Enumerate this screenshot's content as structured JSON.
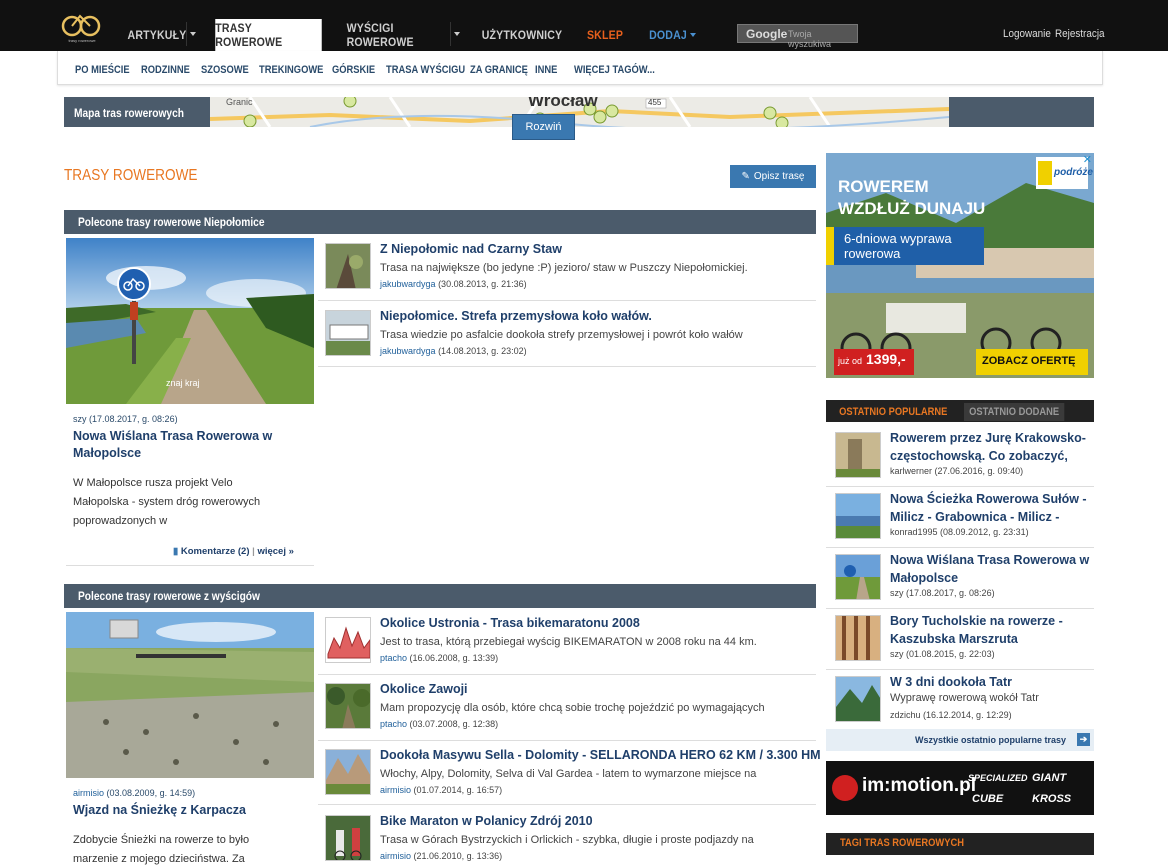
{
  "nav": {
    "items": [
      "Artykuły",
      "Trasy rowerowe",
      "Wyścigi rowerowe",
      "Użytkownicy",
      "Sklep",
      "Dodaj"
    ],
    "search_placeholder": "Twoja wyszukiwa",
    "search_brand": "Google",
    "login": "Logowanie",
    "register": "Rejestracja"
  },
  "subnav": [
    "Po mieście",
    "Rodzinne",
    "Szosowe",
    "Trekingowe",
    "Górskie",
    "Trasa wyścigu",
    "Za granicę",
    "Inne",
    "Więcej tagów..."
  ],
  "map": {
    "label": "Mapa tras rowerowych",
    "expand": "Rozwiń",
    "place_label": "Wrocław",
    "road": "455",
    "place2": "Granic"
  },
  "page_title": "Trasy rowerowe",
  "add_route_button": "Opisz trasę",
  "section1": {
    "title": "Polecone trasy rowerowe Niepołomice",
    "feature": {
      "meta": "szy (17.08.2017, g. 08:26)",
      "title": "Nowa Wiślana Trasa Rowerowa w Małopolsce",
      "desc": "W Małopolsce rusza projekt Velo Małopolska - system dróg rowerowych poprowadzonych w",
      "comments": "Komentarze (2)",
      "more": "więcej »",
      "watermark": "znaj kraj"
    },
    "items": [
      {
        "title": "Z Niepołomic nad Czarny Staw",
        "desc": "Trasa na największe (bo jedyne :P) jezioro/ staw w Puszczy Niepołomickiej.",
        "author": "jakubwardyga",
        "date": "(30.08.2013, g. 21:36)"
      },
      {
        "title": "Niepołomice. Strefa przemysłowa koło wałów.",
        "desc": "Trasa wiedzie po asfalcie dookoła strefy przemysłowej i powrót koło wałów",
        "author": "jakubwardyga",
        "date": "(14.08.2013, g. 23:02)"
      }
    ]
  },
  "section2": {
    "title": "Polecone trasy rowerowe z wyścigów",
    "feature": {
      "meta_author": "airmisio",
      "meta_date": "(03.08.2009, g. 14:59)",
      "title": "Wjazd na Śnieżkę z Karpacza",
      "desc": "Zdobycie Śnieżki na rowerze to było marzenie z mojego dzieciństwa. Za"
    },
    "items": [
      {
        "title": "Okolice Ustronia - Trasa bikemaratonu 2008",
        "desc": "Jest to trasa, którą przebiegał wyścig BIKEMARATON w 2008 roku na 44 km.",
        "author": "ptacho",
        "date": "(16.06.2008, g. 13:39)"
      },
      {
        "title": "Okolice Zawoji",
        "desc": "Mam propozycję dla osób, które chcą sobie trochę pojeździć po wymagających",
        "author": "ptacho",
        "date": "(03.07.2008, g. 12:38)"
      },
      {
        "title": "Dookoła Masywu Sella - Dolomity - SELLARONDA HERO 62 KM / 3.300 HM",
        "desc": "Włochy, Alpy, Dolomity, Selva di Val Gardea - latem to wymarzone miejsce na",
        "author": "airmisio",
        "date": "(01.07.2014, g. 16:57)"
      },
      {
        "title": "Bike Maraton w Polanicy Zdrój 2010",
        "desc": "Trasa w Górach Bystrzyckich i Orlickich - szybka, długie i proste podjazdy na",
        "author": "airmisio",
        "date": "(21.06.2010, g. 13:36)"
      }
    ]
  },
  "ad": {
    "headline1": "ROWEREM",
    "headline2": "WZDŁUŻ DUNAJU",
    "sub1": "6-dniowa wyprawa",
    "sub2": "rowerowa",
    "price_prefix": "już od",
    "price": "1399,-",
    "cta": "ZOBACZ OFERTĘ",
    "brand": "podróże"
  },
  "popular": {
    "tab_active": "Ostatnio popularne",
    "tab_inactive": "Ostatnio dodane",
    "items": [
      {
        "title": "Rowerem przez Jurę Krakowsko-częstochowską. Co zobaczyć,",
        "desc": "",
        "meta": "karlwerner (27.06.2016, g. 09:40)"
      },
      {
        "title": "Nowa Ścieżka Rowerowa Sułów - Milicz - Grabownica - Milicz -",
        "desc": "",
        "meta": "konrad1995 (08.09.2012, g. 23:31)"
      },
      {
        "title": "Nowa Wiślana Trasa Rowerowa w Małopolsce",
        "desc": "",
        "meta": "szy (17.08.2017, g. 08:26)"
      },
      {
        "title": "Bory Tucholskie na rowerze - Kaszubska Marszruta",
        "desc": "",
        "meta": "szy (01.08.2015, g. 22:03)"
      },
      {
        "title": "W 3 dni dookoła Tatr",
        "desc": "Wyprawę rowerową wokół Tatr",
        "meta": "zdzichu (16.12.2014, g. 12:29)"
      }
    ],
    "all_link": "Wszystkie ostatnio popularne trasy",
    "arrow": "➔"
  },
  "sponsor": {
    "name": "im:motion.pl",
    "brands": [
      "SPECIALIZED",
      "GIANT",
      "CUBE",
      "KROSS"
    ]
  },
  "tags_title": "Tagi tras rowerowych"
}
